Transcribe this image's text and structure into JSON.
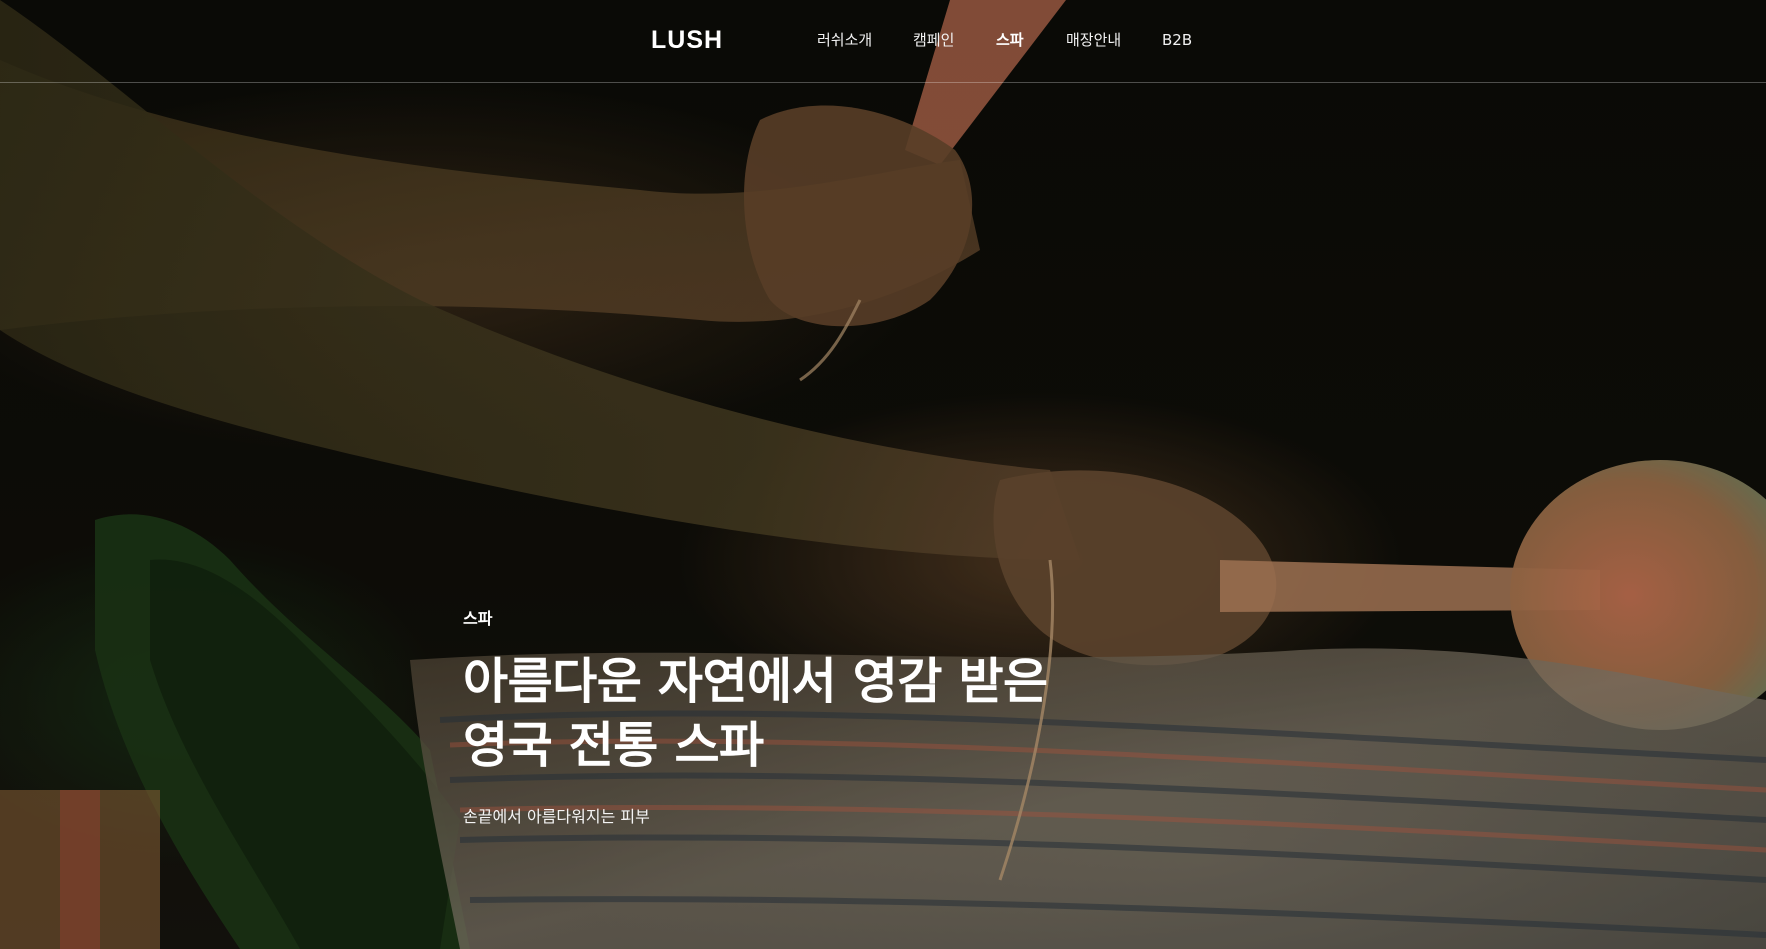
{
  "header": {
    "logo": "LUSH",
    "nav": [
      {
        "label": "러쉬소개",
        "active": false
      },
      {
        "label": "캠페인",
        "active": false
      },
      {
        "label": "스파",
        "active": true
      },
      {
        "label": "매장안내",
        "active": false
      },
      {
        "label": "B2B",
        "active": false
      }
    ]
  },
  "hero": {
    "eyebrow": "스파",
    "headline_line1": "아름다운 자연에서 영감 받은",
    "headline_line2": "영국 전통 스파",
    "subline": "손끝에서 아름다워지는 피부"
  },
  "colors": {
    "text": "#ffffff",
    "background": "#0b0c07",
    "divider": "rgba(255,255,255,0.28)"
  }
}
